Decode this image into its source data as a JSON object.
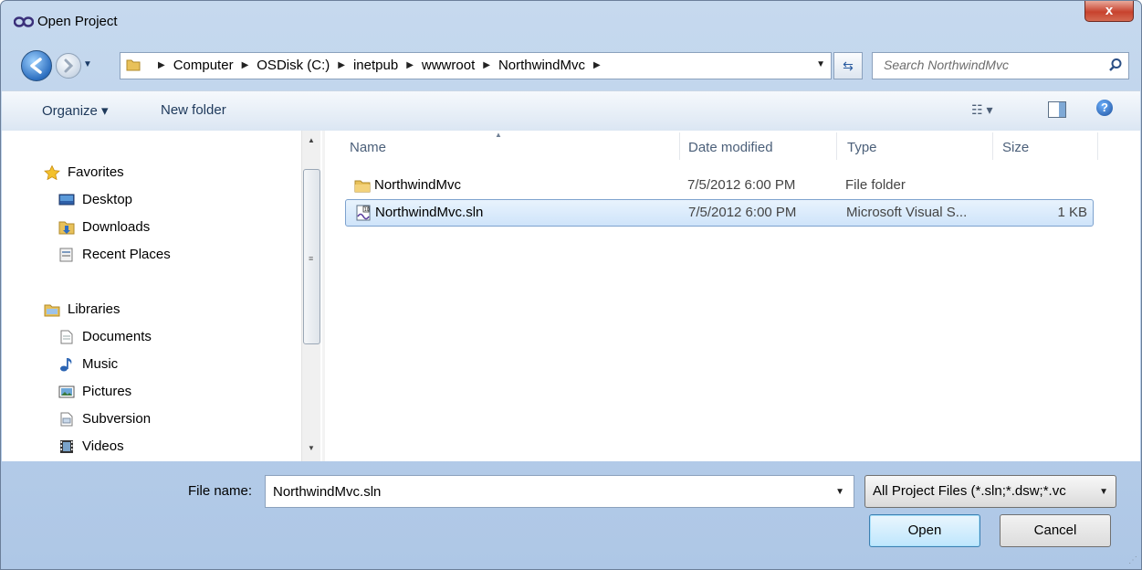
{
  "window": {
    "title": "Open Project",
    "close_label": "x"
  },
  "address": {
    "crumbs": [
      "Computer",
      "OSDisk (C:)",
      "inetpub",
      "wwwroot",
      "NorthwindMvc"
    ]
  },
  "search": {
    "placeholder": "Search NorthwindMvc"
  },
  "toolbar": {
    "organize": "Organize ▾",
    "new_folder": "New folder",
    "help": "?"
  },
  "nav": {
    "favorites": {
      "label": "Favorites",
      "items": [
        "Desktop",
        "Downloads",
        "Recent Places"
      ]
    },
    "libraries": {
      "label": "Libraries",
      "items": [
        "Documents",
        "Music",
        "Pictures",
        "Subversion",
        "Videos"
      ]
    }
  },
  "columns": {
    "name": "Name",
    "date": "Date modified",
    "type": "Type",
    "size": "Size"
  },
  "files": [
    {
      "name": "NorthwindMvc",
      "date": "7/5/2012 6:00 PM",
      "type": "File folder",
      "size": "",
      "icon": "folder-icon"
    },
    {
      "name": "NorthwindMvc.sln",
      "date": "7/5/2012 6:00 PM",
      "type": "Microsoft Visual S...",
      "size": "1 KB",
      "icon": "solution-file-icon",
      "selected": true
    }
  ],
  "bottom": {
    "file_name_label": "File name:",
    "file_name_value": "NorthwindMvc.sln",
    "filter_value": "All Project Files (*.sln;*.dsw;*.vc",
    "open_label": "Open",
    "cancel_label": "Cancel"
  },
  "colors": {
    "selection": "#cfe4fa",
    "chrome": "#c6d9ee",
    "close": "#c7422e"
  }
}
